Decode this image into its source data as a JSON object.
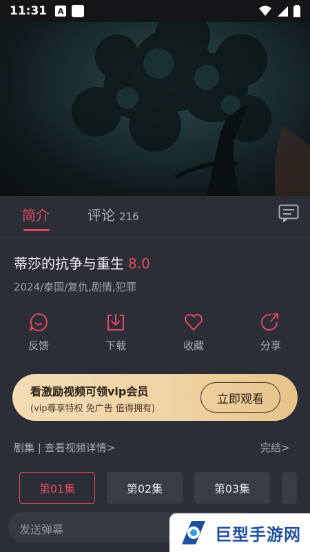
{
  "status_bar": {
    "time": "11:31",
    "notif_letter": "A"
  },
  "tabs": {
    "intro_label": "简介",
    "comments_label": "评论",
    "comments_count": "216"
  },
  "video": {
    "title": "蒂莎的抗争与重生",
    "rating": "8.0",
    "meta": "2024/泰国/复仇,剧情,犯罪"
  },
  "actions": [
    {
      "label": "反馈",
      "icon": "feedback-icon"
    },
    {
      "label": "下载",
      "icon": "download-icon"
    },
    {
      "label": "收藏",
      "icon": "heart-icon"
    },
    {
      "label": "分享",
      "icon": "share-icon"
    }
  ],
  "vip": {
    "title": "看激励视频可领vip会员",
    "subtitle": "(vip尊享特权 免广告 值得拥有)",
    "button": "立即观看"
  },
  "episodes": {
    "header": "剧集 | 查看视频详情>",
    "status": "完结>",
    "items": [
      "第01集",
      "第02集",
      "第03集"
    ]
  },
  "danmaku": {
    "placeholder": "发送弹幕"
  },
  "watermark": {
    "text": "巨型手游网"
  },
  "colors": {
    "accent": "#e5485e",
    "background": "#2b2e36",
    "vip_gold": "#efd2a3"
  }
}
